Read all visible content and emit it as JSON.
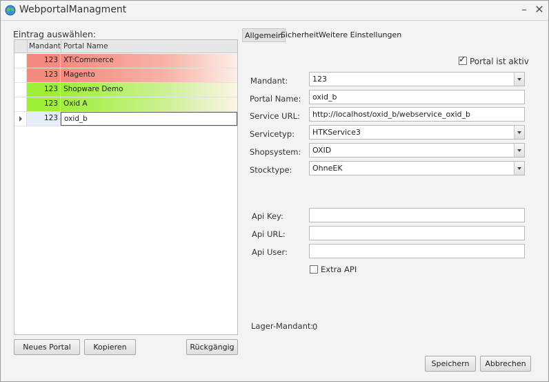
{
  "window": {
    "title": "WebportalManagment",
    "minimize_glyph": "–",
    "close_glyph": "✕"
  },
  "left": {
    "select_label": "Eintrag auswählen:",
    "columns": [
      "Mandant",
      "Portal Name"
    ],
    "rows": [
      {
        "mandant": "123",
        "name": "XT:Commerce"
      },
      {
        "mandant": "123",
        "name": "Magento"
      },
      {
        "mandant": "123",
        "name": "Shopware Demo"
      },
      {
        "mandant": "123",
        "name": "Oxid A"
      },
      {
        "mandant": "123",
        "name": "oxid_b"
      }
    ],
    "buttons": {
      "new": "Neues Portal",
      "copy": "Kopieren",
      "undo": "Rückgängig"
    }
  },
  "tabs": [
    "Allgemein",
    "Sicherheit",
    "Weitere Einstellungen"
  ],
  "form": {
    "active_label": "Portal ist aktiv",
    "mandant_label": "Mandant:",
    "mandant_value": "123",
    "portal_name_label": "Portal Name:",
    "portal_name_value": "oxid_b",
    "service_url_label": "Service URL:",
    "service_url_value": "http://localhost/oxid_b/webservice_oxid_b",
    "servicetyp_label": "Servicetyp:",
    "servicetyp_value": "HTKService3",
    "shopsystem_label": "Shopsystem:",
    "shopsystem_value": "OXID",
    "stocktype_label": "Stocktype:",
    "stocktype_value": "OhneEK",
    "api_key_label": "Api Key:",
    "api_key_value": "",
    "api_url_label": "Api URL:",
    "api_url_value": "",
    "api_user_label": "Api User:",
    "api_user_value": "",
    "extra_api_label": "Extra API",
    "lager_mandant_label": "Lager-Mandant:",
    "lager_mandant_value": "0"
  },
  "actions": {
    "save": "Speichern",
    "cancel": "Abbrechen"
  },
  "colors": {
    "row_red": "#f58a7f",
    "row_green": "#9df037",
    "selected_bg": "#e6eefa"
  },
  "icons": {
    "app": "globe-icon",
    "minimize": "minimize-icon",
    "close": "close-icon",
    "checkbox": "checkbox-icon"
  }
}
